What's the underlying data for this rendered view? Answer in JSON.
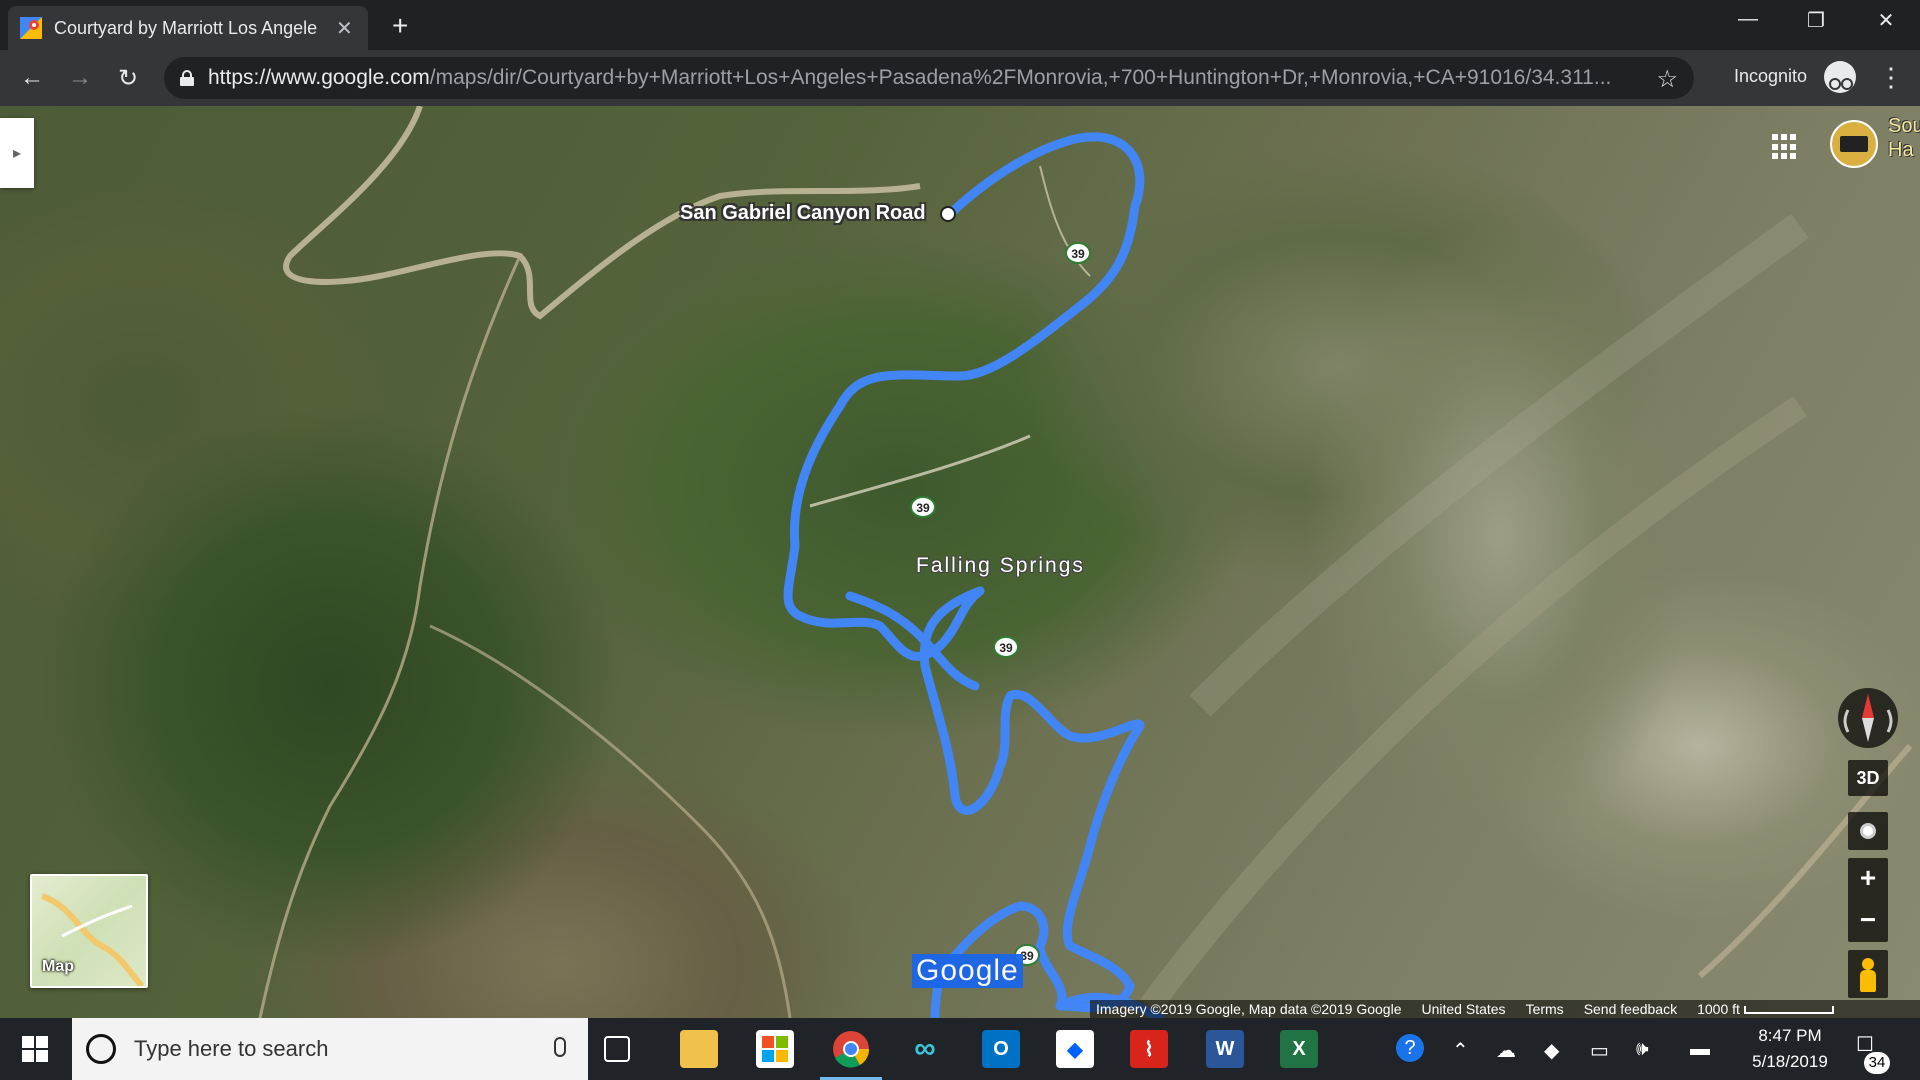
{
  "browser": {
    "tab_title": "Courtyard by Marriott Los Angele",
    "tab_close": "✕",
    "new_tab": "+",
    "url_host": "https://www.google.com",
    "url_path": "/maps/dir/Courtyard+by+Marriott+Los+Angeles+Pasadena%2FMonrovia,+700+Huntington+Dr,+Monrovia,+CA+91016/34.311...",
    "incognito_label": "Incognito",
    "window_controls": {
      "minimize": "—",
      "restore": "❐",
      "close": "✕"
    },
    "nav": {
      "back": "←",
      "forward": "→",
      "reload": "↻",
      "star": "☆",
      "menu": "⋮"
    }
  },
  "map": {
    "place_labels": {
      "road": "San Gabriel Canyon Road",
      "area": "Falling Springs",
      "partial_top_right": "Sou\nHa"
    },
    "route_shields": [
      "39",
      "39",
      "39",
      "39"
    ],
    "route_color": "#4285f4",
    "minimap_label": "Map",
    "controls": {
      "three_d": "3D",
      "zoom_in": "+",
      "zoom_out": "−"
    },
    "google_logo": "Google",
    "attribution": {
      "imagery": "Imagery ©2019 Google, Map data ©2019 Google",
      "country": "United States",
      "terms": "Terms",
      "feedback": "Send feedback",
      "scale": "1000 ft"
    },
    "side_toggle": "▸"
  },
  "taskbar": {
    "search_placeholder": "Type here to search",
    "time": "8:47 PM",
    "date": "5/18/2019",
    "notifications": "34",
    "apps": [
      "task-view",
      "file-explorer",
      "store",
      "chrome",
      "infinity-app",
      "outlook",
      "dropbox",
      "acrobat",
      "word",
      "excel"
    ],
    "app_letters": {
      "outlook": "O",
      "word": "W",
      "excel": "X"
    }
  }
}
